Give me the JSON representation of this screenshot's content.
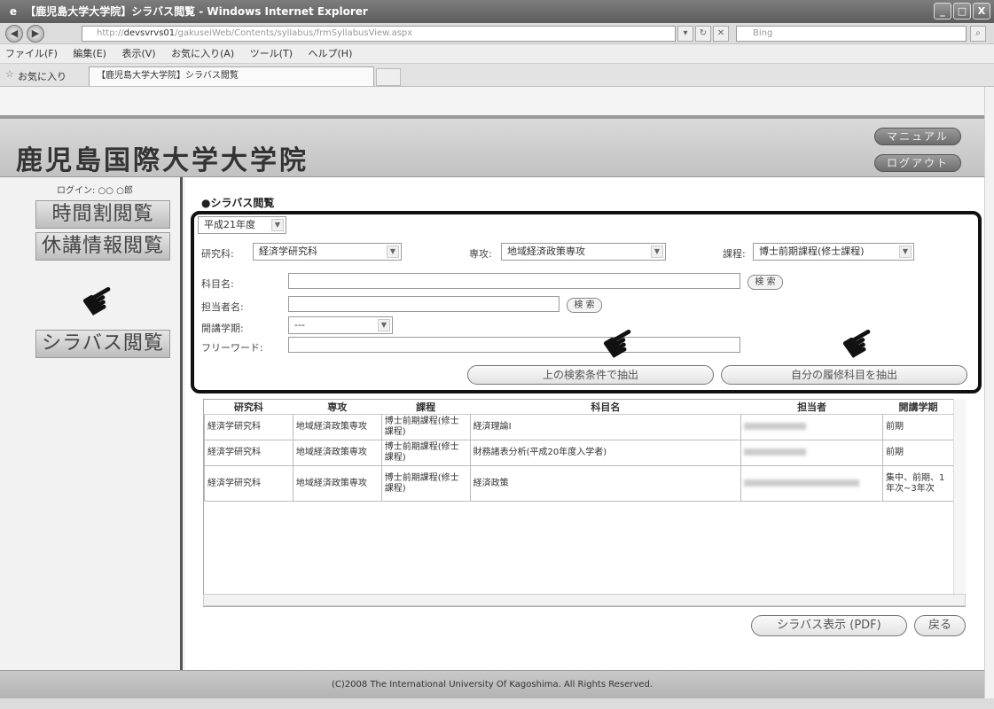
{
  "window": {
    "title": "【鹿児島大学大学院】シラバス閲覧 - Windows Internet Explorer",
    "controls": [
      "_",
      "□",
      "X"
    ]
  },
  "browser": {
    "url_prefix": "http://",
    "url_host": "devsvrvs01",
    "url_path": "/gakuseiWeb/Contents/syllabus/frmSyllabusView.aspx",
    "search_placeholder": "Bing",
    "menu": [
      "ファイル(F)",
      "編集(E)",
      "表示(V)",
      "お気に入り(A)",
      "ツール(T)",
      "ヘルプ(H)"
    ],
    "favorites_label": "お気に入り",
    "tab_title": "【鹿児島大学大学院】シラバス閲覧"
  },
  "header": {
    "site_title": "鹿児島国際大学大学院",
    "manual_button": "マニュアル",
    "logout_button": "ログアウト"
  },
  "sidebar": {
    "login_text": "ログイン: ○○ ○郎",
    "items": [
      "時間割閲覧",
      "休講情報閲覧",
      "シラバス閲覧"
    ]
  },
  "search": {
    "section_title": "●シラバス閲覧",
    "year": "平成21年度",
    "graduate_school_label": "研究科:",
    "graduate_school_value": "経済学研究科",
    "major_label": "専攻:",
    "major_value": "地域経済政策専攻",
    "course_label": "課程:",
    "course_value": "博士前期課程(修士課程)",
    "subject_label": "科目名:",
    "subject_search_button": "検 索",
    "teacher_label": "担当者名:",
    "teacher_search_button": "検 索",
    "term_label": "開講学期:",
    "term_value": "---",
    "freeword_label": "フリーワード:",
    "extract_by_condition_button": "上の検索条件で抽出",
    "extract_my_courses_button": "自分の履修科目を抽出"
  },
  "results": {
    "columns": [
      "研究科",
      "専攻",
      "課程",
      "科目名",
      "担当者",
      "開講学期"
    ],
    "rows": [
      {
        "school": "経済学研究科",
        "major": "地域経済政策専攻",
        "course": "博士前期課程(修士課程)",
        "subject": "経済理論Ⅰ",
        "term": "前期"
      },
      {
        "school": "経済学研究科",
        "major": "地域経済政策専攻",
        "course": "博士前期課程(修士課程)",
        "subject": "財務諸表分析(平成20年度入学者)",
        "term": "前期"
      },
      {
        "school": "経済学研究科",
        "major": "地域経済政策専攻",
        "course": "博士前期課程(修士課程)",
        "subject": "経済政策",
        "term": "集中、前期、1年次~3年次"
      }
    ]
  },
  "actions": {
    "pdf_button": "シラバス表示 (PDF)",
    "back_button": "戻る"
  },
  "footer": {
    "copyright": "(C)2008 The International University Of Kagoshima. All Rights Reserved."
  },
  "colors": {
    "highlight_border": "#111111",
    "header_bg": "#c8c8c8",
    "page_bg": "#ffffff"
  }
}
